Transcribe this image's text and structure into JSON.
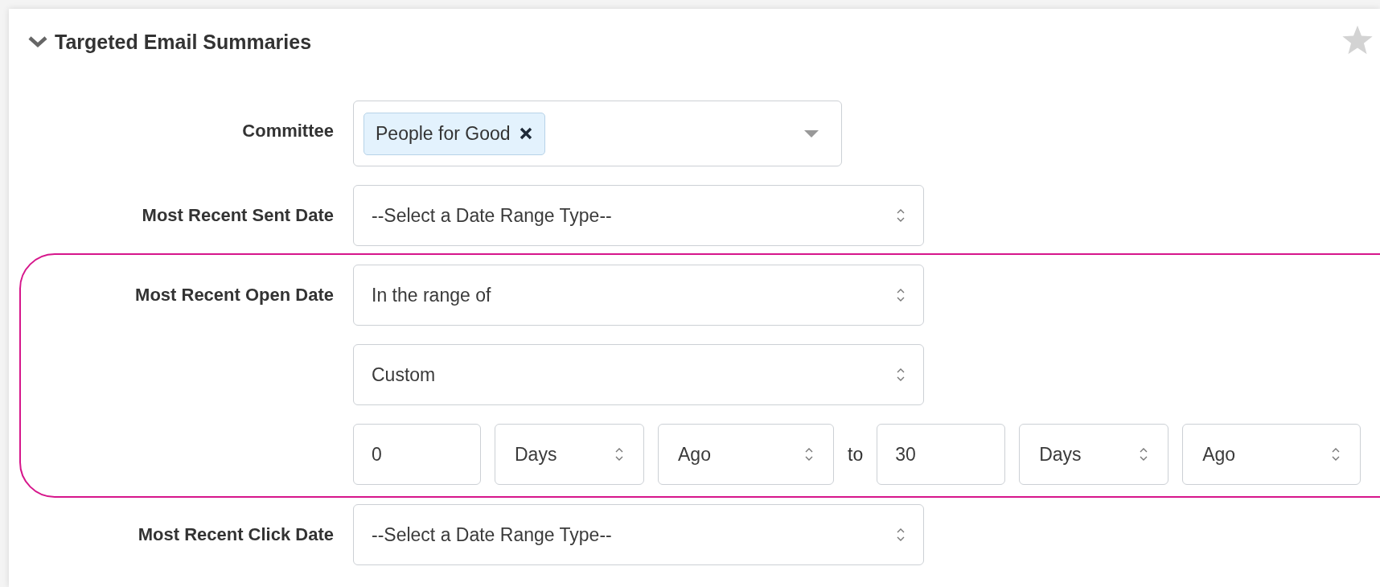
{
  "panel": {
    "title": "Targeted Email Summaries",
    "expanded": true,
    "starred": false
  },
  "fields": [
    {
      "label": "Committee",
      "kind": "multiselect",
      "tags": [
        {
          "label": "People for Good"
        }
      ]
    },
    {
      "label": "Most Recent Sent Date",
      "kind": "date_range",
      "highlighted": false,
      "range_type": "--Select a Date Range Type--"
    },
    {
      "label": "Most Recent Open Date",
      "kind": "date_range",
      "highlighted": true,
      "range_type": "In the range of",
      "preset": "Custom",
      "custom": {
        "from_value": "0",
        "from_unit": "Days",
        "from_direction": "Ago",
        "separator": "to",
        "to_value": "30",
        "to_unit": "Days",
        "to_direction": "Ago"
      }
    },
    {
      "label": "Most Recent Click Date",
      "kind": "date_range",
      "highlighted": false,
      "range_type": "--Select a Date Range Type--"
    }
  ]
}
